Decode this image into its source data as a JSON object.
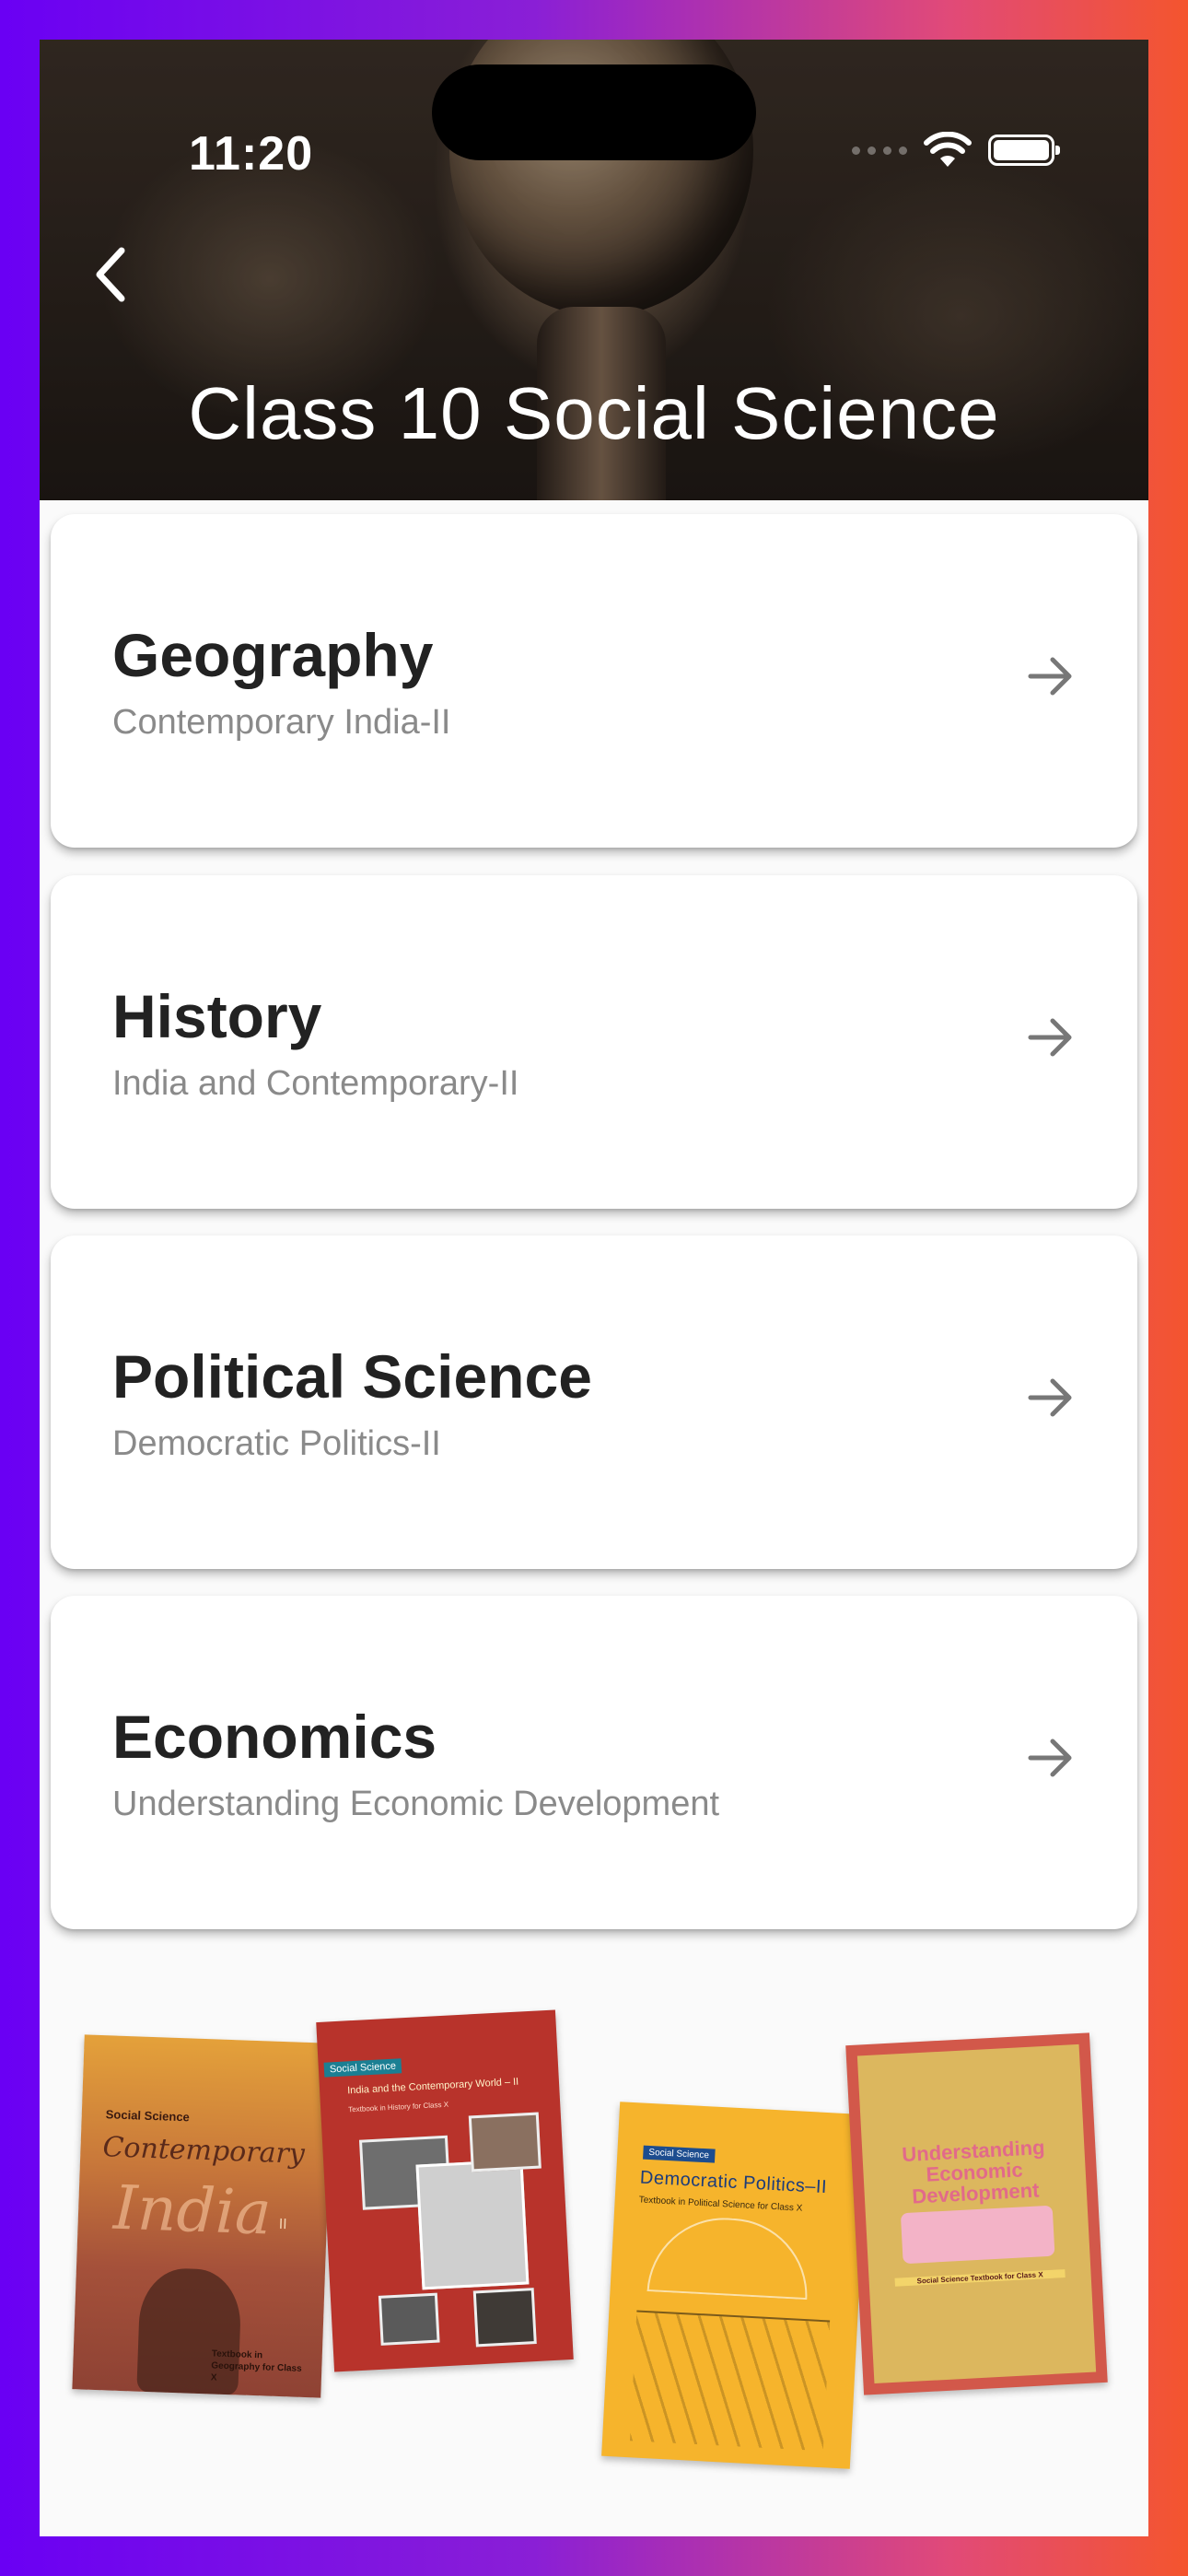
{
  "status_bar": {
    "time": "11:20"
  },
  "header": {
    "title": "Class 10 Social Science"
  },
  "subjects": [
    {
      "title": "Geography",
      "subtitle": "Contemporary India-II"
    },
    {
      "title": "History",
      "subtitle": "India and Contemporary-II"
    },
    {
      "title": "Political Science",
      "subtitle": "Democratic Politics-II"
    },
    {
      "title": "Economics",
      "subtitle": "Understanding Economic Development"
    }
  ],
  "books": [
    {
      "series": "Social Science",
      "title": "Contemporary",
      "title2": "India",
      "numeral": "II",
      "caption": "Textbook in Geography for Class X"
    },
    {
      "series": "Social Science",
      "title": "India and the Contemporary World – II",
      "caption": "Textbook in History for Class X"
    },
    {
      "series": "Social Science",
      "title": "Democratic Politics–II",
      "caption": "Textbook in Political Science for Class X"
    },
    {
      "title": "Understanding Economic Development",
      "caption": "Social Science Textbook for Class X"
    }
  ]
}
